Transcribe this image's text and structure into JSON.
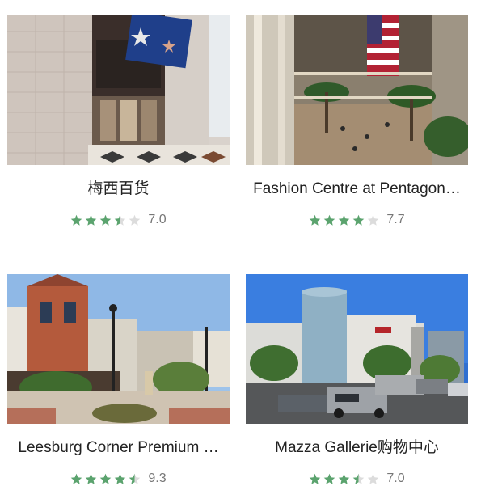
{
  "colors": {
    "star_filled": "#5ba36e",
    "star_empty": "#dcdcdc",
    "title_text": "#222222",
    "score_text": "#777777"
  },
  "cards": [
    {
      "title": "梅西百货",
      "rating": 3.5,
      "score": "7.0",
      "image": "macys-storefront-photo"
    },
    {
      "title": "Fashion Centre at Pentagon…",
      "rating": 4,
      "score": "7.7",
      "image": "mall-atrium-photo"
    },
    {
      "title": "Leesburg Corner Premium …",
      "rating": 4.5,
      "score": "9.3",
      "image": "outlet-street-photo"
    },
    {
      "title": "Mazza Gallerie购物中心",
      "rating": 3.5,
      "score": "7.0",
      "image": "mall-building-exterior-photo"
    }
  ]
}
